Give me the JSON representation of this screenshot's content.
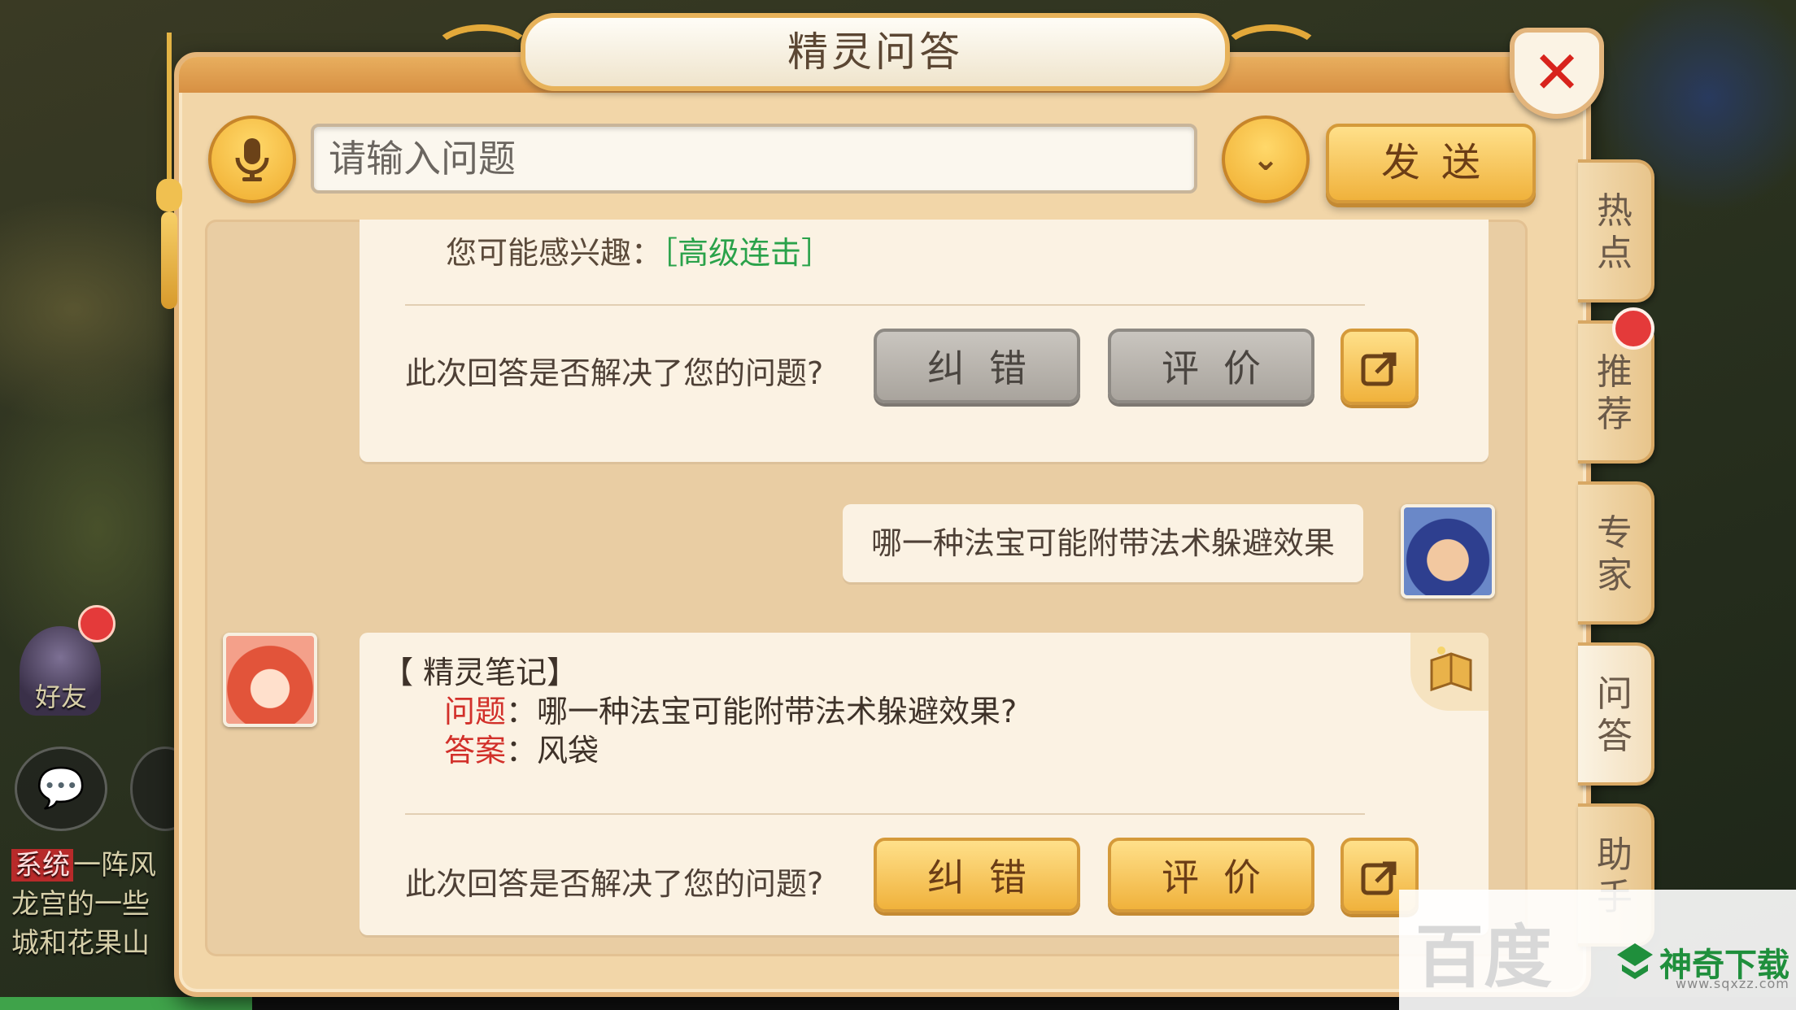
{
  "dialog": {
    "title": "精灵问答",
    "close_label": "✕"
  },
  "input": {
    "placeholder": "请输入问题",
    "send_label": "发送"
  },
  "chat": {
    "card1": {
      "interest_prefix": "您可能感兴趣：",
      "interest_link": "［高级连击］",
      "feedback_question": "此次回答是否解决了您的问题?",
      "correct_label": "纠错",
      "rate_label": "评价"
    },
    "user_message": "哪一种法宝可能附带法术躲避效果",
    "card2": {
      "note_title": "【 精灵笔记】",
      "question_key": "问题",
      "question_value": "哪一种法宝可能附带法术躲避效果?",
      "answer_key": "答案",
      "answer_value": "风袋",
      "feedback_question": "此次回答是否解决了您的问题?",
      "correct_label": "纠错",
      "rate_label": "评价"
    }
  },
  "side_tabs": [
    {
      "label": "热\n点",
      "active": false
    },
    {
      "label": "推\n荐",
      "active": false,
      "badge": true
    },
    {
      "label": "专\n家",
      "active": false
    },
    {
      "label": "问\n答",
      "active": true
    },
    {
      "label": "助\n手",
      "active": false
    }
  ],
  "background": {
    "friend_label": "好友",
    "chat_lines": [
      "一阵风",
      "龙宫的一些",
      "城和花果山"
    ],
    "chat_tag": "系统"
  },
  "watermark": {
    "brand": "百度",
    "site_name": "神奇下载",
    "site_url": "www.sqxzz.com"
  },
  "colors": {
    "accent_gold": "#f0b23c",
    "link_green": "#2aa24a",
    "key_red": "#d2302a",
    "close_red": "#d8231c"
  },
  "icons": [
    "microphone-icon",
    "chevron-down-icon",
    "share-icon",
    "book-icon",
    "chat-icon",
    "close-icon"
  ]
}
